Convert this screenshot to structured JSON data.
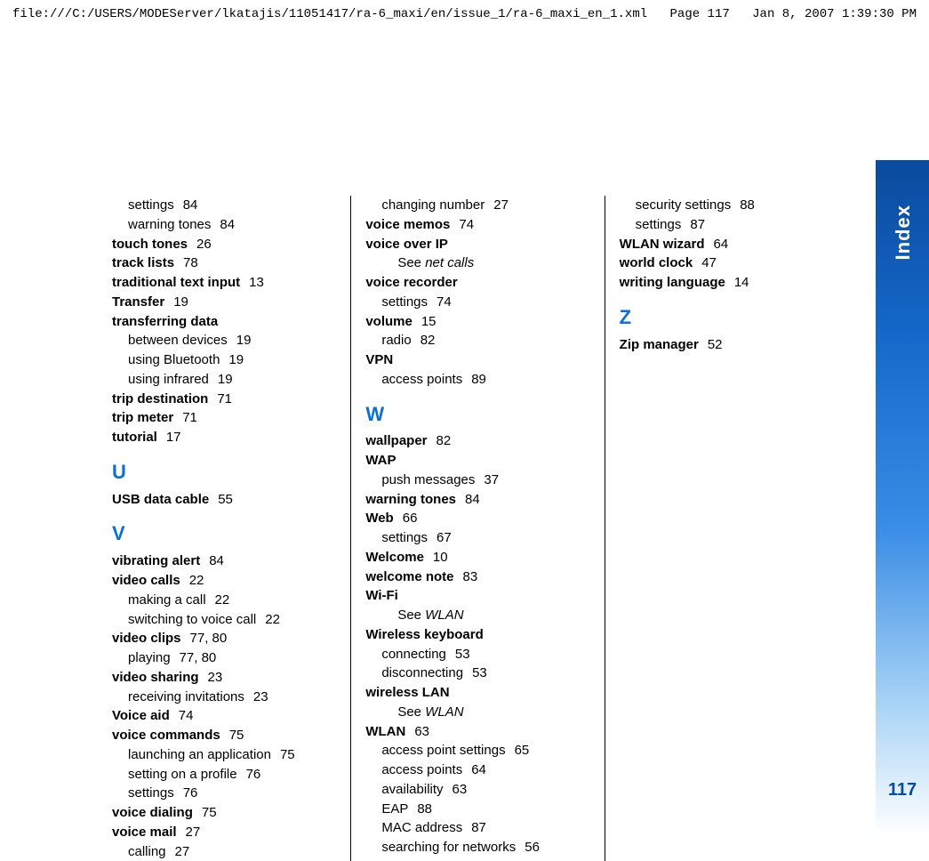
{
  "header": {
    "path": "file:///C:/USERS/MODEServer/lkatajis/11051417/ra-6_maxi/en/issue_1/ra-6_maxi_en_1.xml",
    "page": "Page 117",
    "datetime": "Jan 8, 2007 1:39:30 PM"
  },
  "sidebar": {
    "label": "Index",
    "page_number": "117"
  },
  "columns": {
    "c1": {
      "e1_sub1": "settings",
      "e1_sub1_pg": "84",
      "e1_sub2": "warning tones",
      "e1_sub2_pg": "84",
      "e2": "touch tones",
      "e2_pg": "26",
      "e3": "track lists",
      "e3_pg": "78",
      "e4": "traditional text input",
      "e4_pg": "13",
      "e5": "Transfer",
      "e5_pg": "19",
      "e6": "transferring data",
      "e6_sub1": "between devices",
      "e6_sub1_pg": "19",
      "e6_sub2": "using Bluetooth",
      "e6_sub2_pg": "19",
      "e6_sub3": "using infrared",
      "e6_sub3_pg": "19",
      "e7": "trip destination",
      "e7_pg": "71",
      "e8": "trip meter",
      "e8_pg": "71",
      "e9": "tutorial",
      "e9_pg": "17",
      "letter_u": "U",
      "u1": "USB data cable",
      "u1_pg": "55",
      "letter_v": "V",
      "v1": "vibrating alert",
      "v1_pg": "84",
      "v2": "video calls",
      "v2_pg": "22",
      "v2_sub1": "making a call",
      "v2_sub1_pg": "22",
      "v2_sub2": "switching to voice call",
      "v2_sub2_pg": "22",
      "v3": "video clips",
      "v3_pg": "77, 80",
      "v3_sub1": "playing",
      "v3_sub1_pg": "77, 80",
      "v4": "video sharing",
      "v4_pg": "23",
      "v4_sub1": "receiving invitations",
      "v4_sub1_pg": "23",
      "v5": "Voice aid",
      "v5_pg": "74",
      "v6": "voice commands",
      "v6_pg": "75",
      "v6_sub1": "launching an application",
      "v6_sub1_pg": "75",
      "v6_sub2": "setting on a profile",
      "v6_sub2_pg": "76",
      "v6_sub3": "settings",
      "v6_sub3_pg": "76",
      "v7": "voice dialing",
      "v7_pg": "75",
      "v8": "voice mail",
      "v8_pg": "27",
      "v8_sub1": "calling",
      "v8_sub1_pg": "27"
    },
    "c2": {
      "top_sub": "changing number",
      "top_sub_pg": "27",
      "vm1": "voice memos",
      "vm1_pg": "74",
      "vip": "voice over IP",
      "vip_see_prefix": "See ",
      "vip_see": "net calls",
      "vr": "voice recorder",
      "vr_sub1": "settings",
      "vr_sub1_pg": "74",
      "vol": "volume",
      "vol_pg": "15",
      "vol_sub1": "radio",
      "vol_sub1_pg": "82",
      "vpn": "VPN",
      "vpn_sub1": "access points",
      "vpn_sub1_pg": "89",
      "letter_w": "W",
      "w1": "wallpaper",
      "w1_pg": "82",
      "w2": "WAP",
      "w2_sub1": "push messages",
      "w2_sub1_pg": "37",
      "w3": "warning tones",
      "w3_pg": "84",
      "w4": "Web",
      "w4_pg": "66",
      "w4_sub1": "settings",
      "w4_sub1_pg": "67",
      "w5": "Welcome",
      "w5_pg": "10",
      "w6": "welcome note",
      "w6_pg": "83",
      "w7": "Wi-Fi",
      "w7_see_prefix": "See ",
      "w7_see": "WLAN",
      "w8": "Wireless keyboard",
      "w8_sub1": "connecting",
      "w8_sub1_pg": "53",
      "w8_sub2": "disconnecting",
      "w8_sub2_pg": "53",
      "w9": "wireless LAN",
      "w9_see_prefix": "See ",
      "w9_see": "WLAN",
      "w10": "WLAN",
      "w10_pg": "63",
      "w10_sub1": "access point settings",
      "w10_sub1_pg": "65",
      "w10_sub2": "access points",
      "w10_sub2_pg": "64",
      "w10_sub3": "availability",
      "w10_sub3_pg": "63",
      "w10_sub4": "EAP",
      "w10_sub4_pg": "88",
      "w10_sub5": "MAC address",
      "w10_sub5_pg": "87",
      "w10_sub6": "searching for networks",
      "w10_sub6_pg": "56"
    },
    "c3": {
      "top_sub1": "security settings",
      "top_sub1_pg": "88",
      "top_sub2": "settings",
      "top_sub2_pg": "87",
      "ww": "WLAN wizard",
      "ww_pg": "64",
      "wc": "world clock",
      "wc_pg": "47",
      "wl": "writing language",
      "wl_pg": "14",
      "letter_z": "Z",
      "z1": "Zip manager",
      "z1_pg": "52"
    }
  }
}
